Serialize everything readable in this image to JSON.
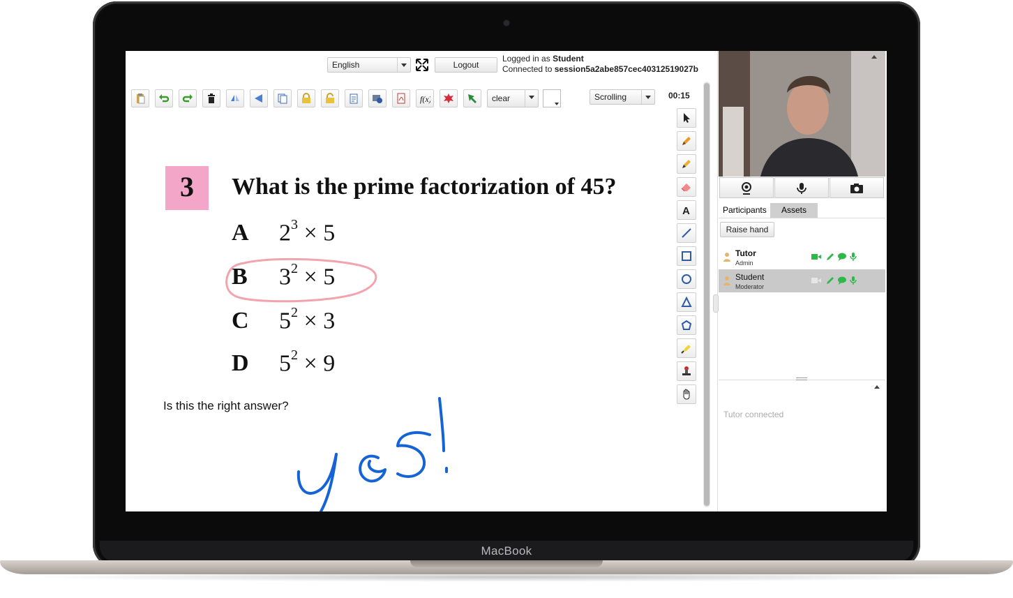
{
  "device": {
    "brand": "MacBook"
  },
  "header": {
    "language": "English",
    "logout_label": "Logout",
    "logged_in_prefix": "Logged in as ",
    "logged_in_user": "Student",
    "connected_prefix": "Connected to ",
    "session_id": "session5a2abe857cec40312519027b"
  },
  "toolbar": {
    "icons": [
      "paste-icon",
      "undo-icon",
      "redo-icon",
      "trash-icon",
      "flip-vertical-icon",
      "flip-horizontal-icon",
      "copy-icon",
      "lock-icon",
      "unlock-icon",
      "insert-page-icon",
      "screenshot-icon",
      "pdf-icon",
      "formula-icon",
      "shape-burst-icon",
      "pointer-arrow-icon"
    ],
    "clear_label": "clear",
    "color_swatch": "#ffffff",
    "scroll_mode": "Scrolling",
    "timer": "00:15"
  },
  "tools": [
    "select-tool-icon",
    "pencil-icon",
    "marker-icon",
    "eraser-icon",
    "text-tool-icon",
    "line-tool-icon",
    "rectangle-tool-icon",
    "circle-tool-icon",
    "triangle-tool-icon",
    "polygon-tool-icon",
    "highlighter-icon",
    "stamp-icon",
    "hand-pan-icon"
  ],
  "question": {
    "number": "3",
    "text": "What is the prime factorization of 45?",
    "options": [
      {
        "letter": "A",
        "base1": "2",
        "exp1": "3",
        "times": "×",
        "base2": "5"
      },
      {
        "letter": "B",
        "base1": "3",
        "exp1": "2",
        "times": "×",
        "base2": "5"
      },
      {
        "letter": "C",
        "base1": "5",
        "exp1": "2",
        "times": "×",
        "base2": "3"
      },
      {
        "letter": "D",
        "base1": "5",
        "exp1": "2",
        "times": "×",
        "base2": "9"
      }
    ],
    "circled_option": "B",
    "prompt": "Is this the right answer?",
    "handwritten_answer": "yes!"
  },
  "colors": {
    "question_badge": "#f4a6c9",
    "circle_annotation": "#f2a3ad",
    "ink": "#1464d6",
    "status_green": "#2fb84a"
  },
  "media_buttons": [
    "webcam-icon",
    "microphone-icon",
    "camera-icon"
  ],
  "panel": {
    "tabs": [
      {
        "label": "Participants",
        "active": true
      },
      {
        "label": "Assets",
        "active": false
      }
    ],
    "raise_hand_label": "Raise hand",
    "participants": [
      {
        "name": "Tutor",
        "role": "Admin"
      },
      {
        "name": "Student",
        "role": "Moderator"
      }
    ],
    "chat_message": "Tutor connected"
  }
}
